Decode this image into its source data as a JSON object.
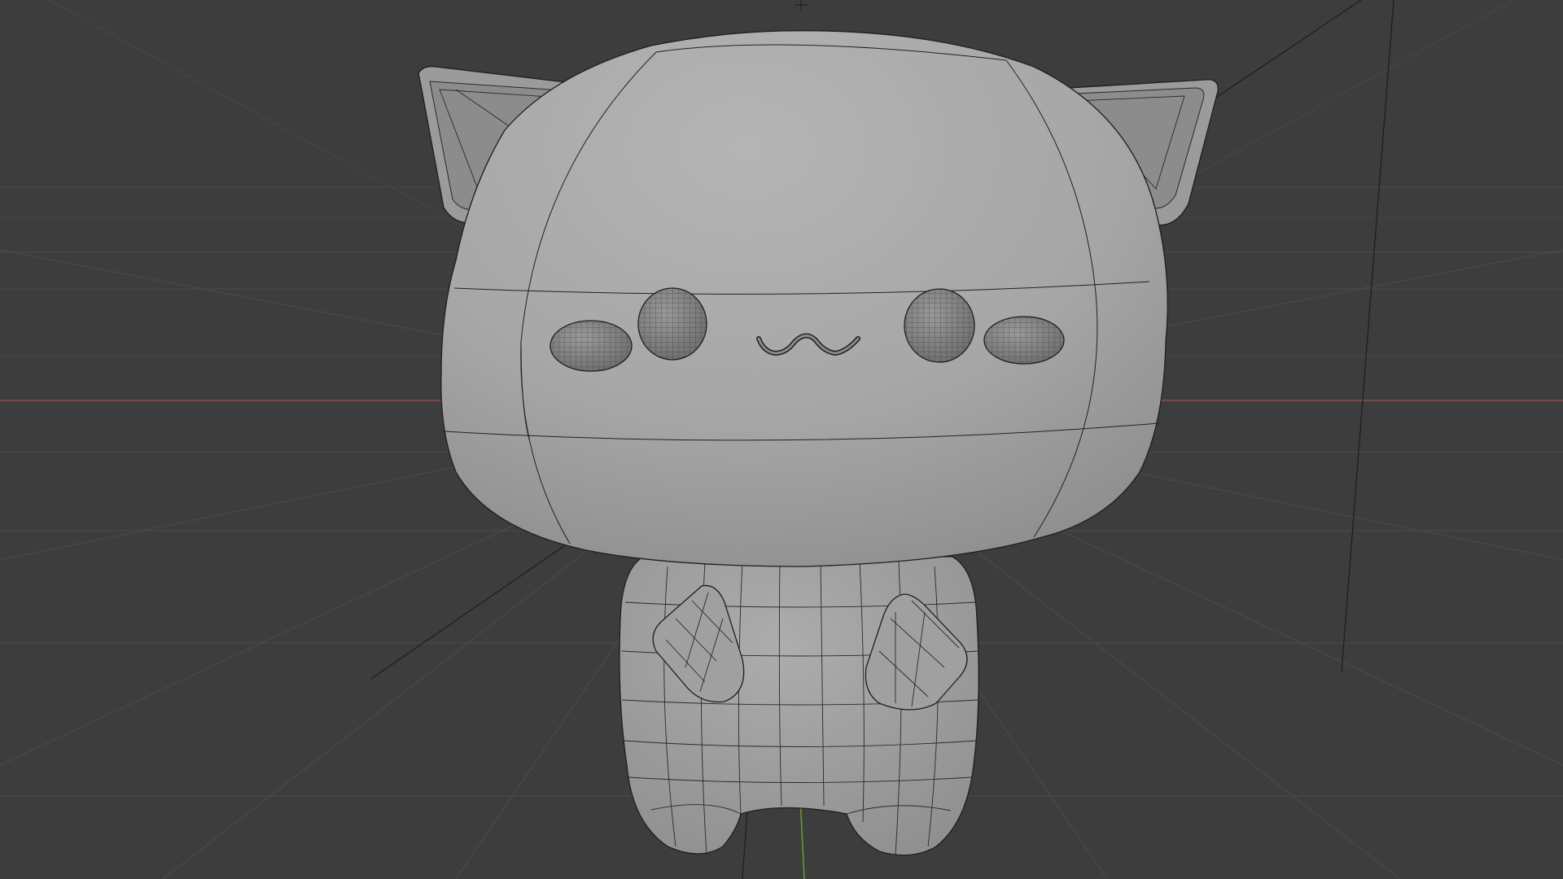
{
  "viewport": {
    "mode": "3d-viewport-solid-shading-with-wireframe",
    "background_color": "#3d3d3d",
    "grid_color": "#4a4a4a",
    "x_axis_color": "#9a4a4a",
    "y_axis_color": "#6a9a3a",
    "mesh_color": "#a4a4a4",
    "wire_color": "#1e1e1e"
  },
  "scene": {
    "object_icon": "cat-mascot-mesh",
    "origin_icon": "object-origin-icon"
  }
}
